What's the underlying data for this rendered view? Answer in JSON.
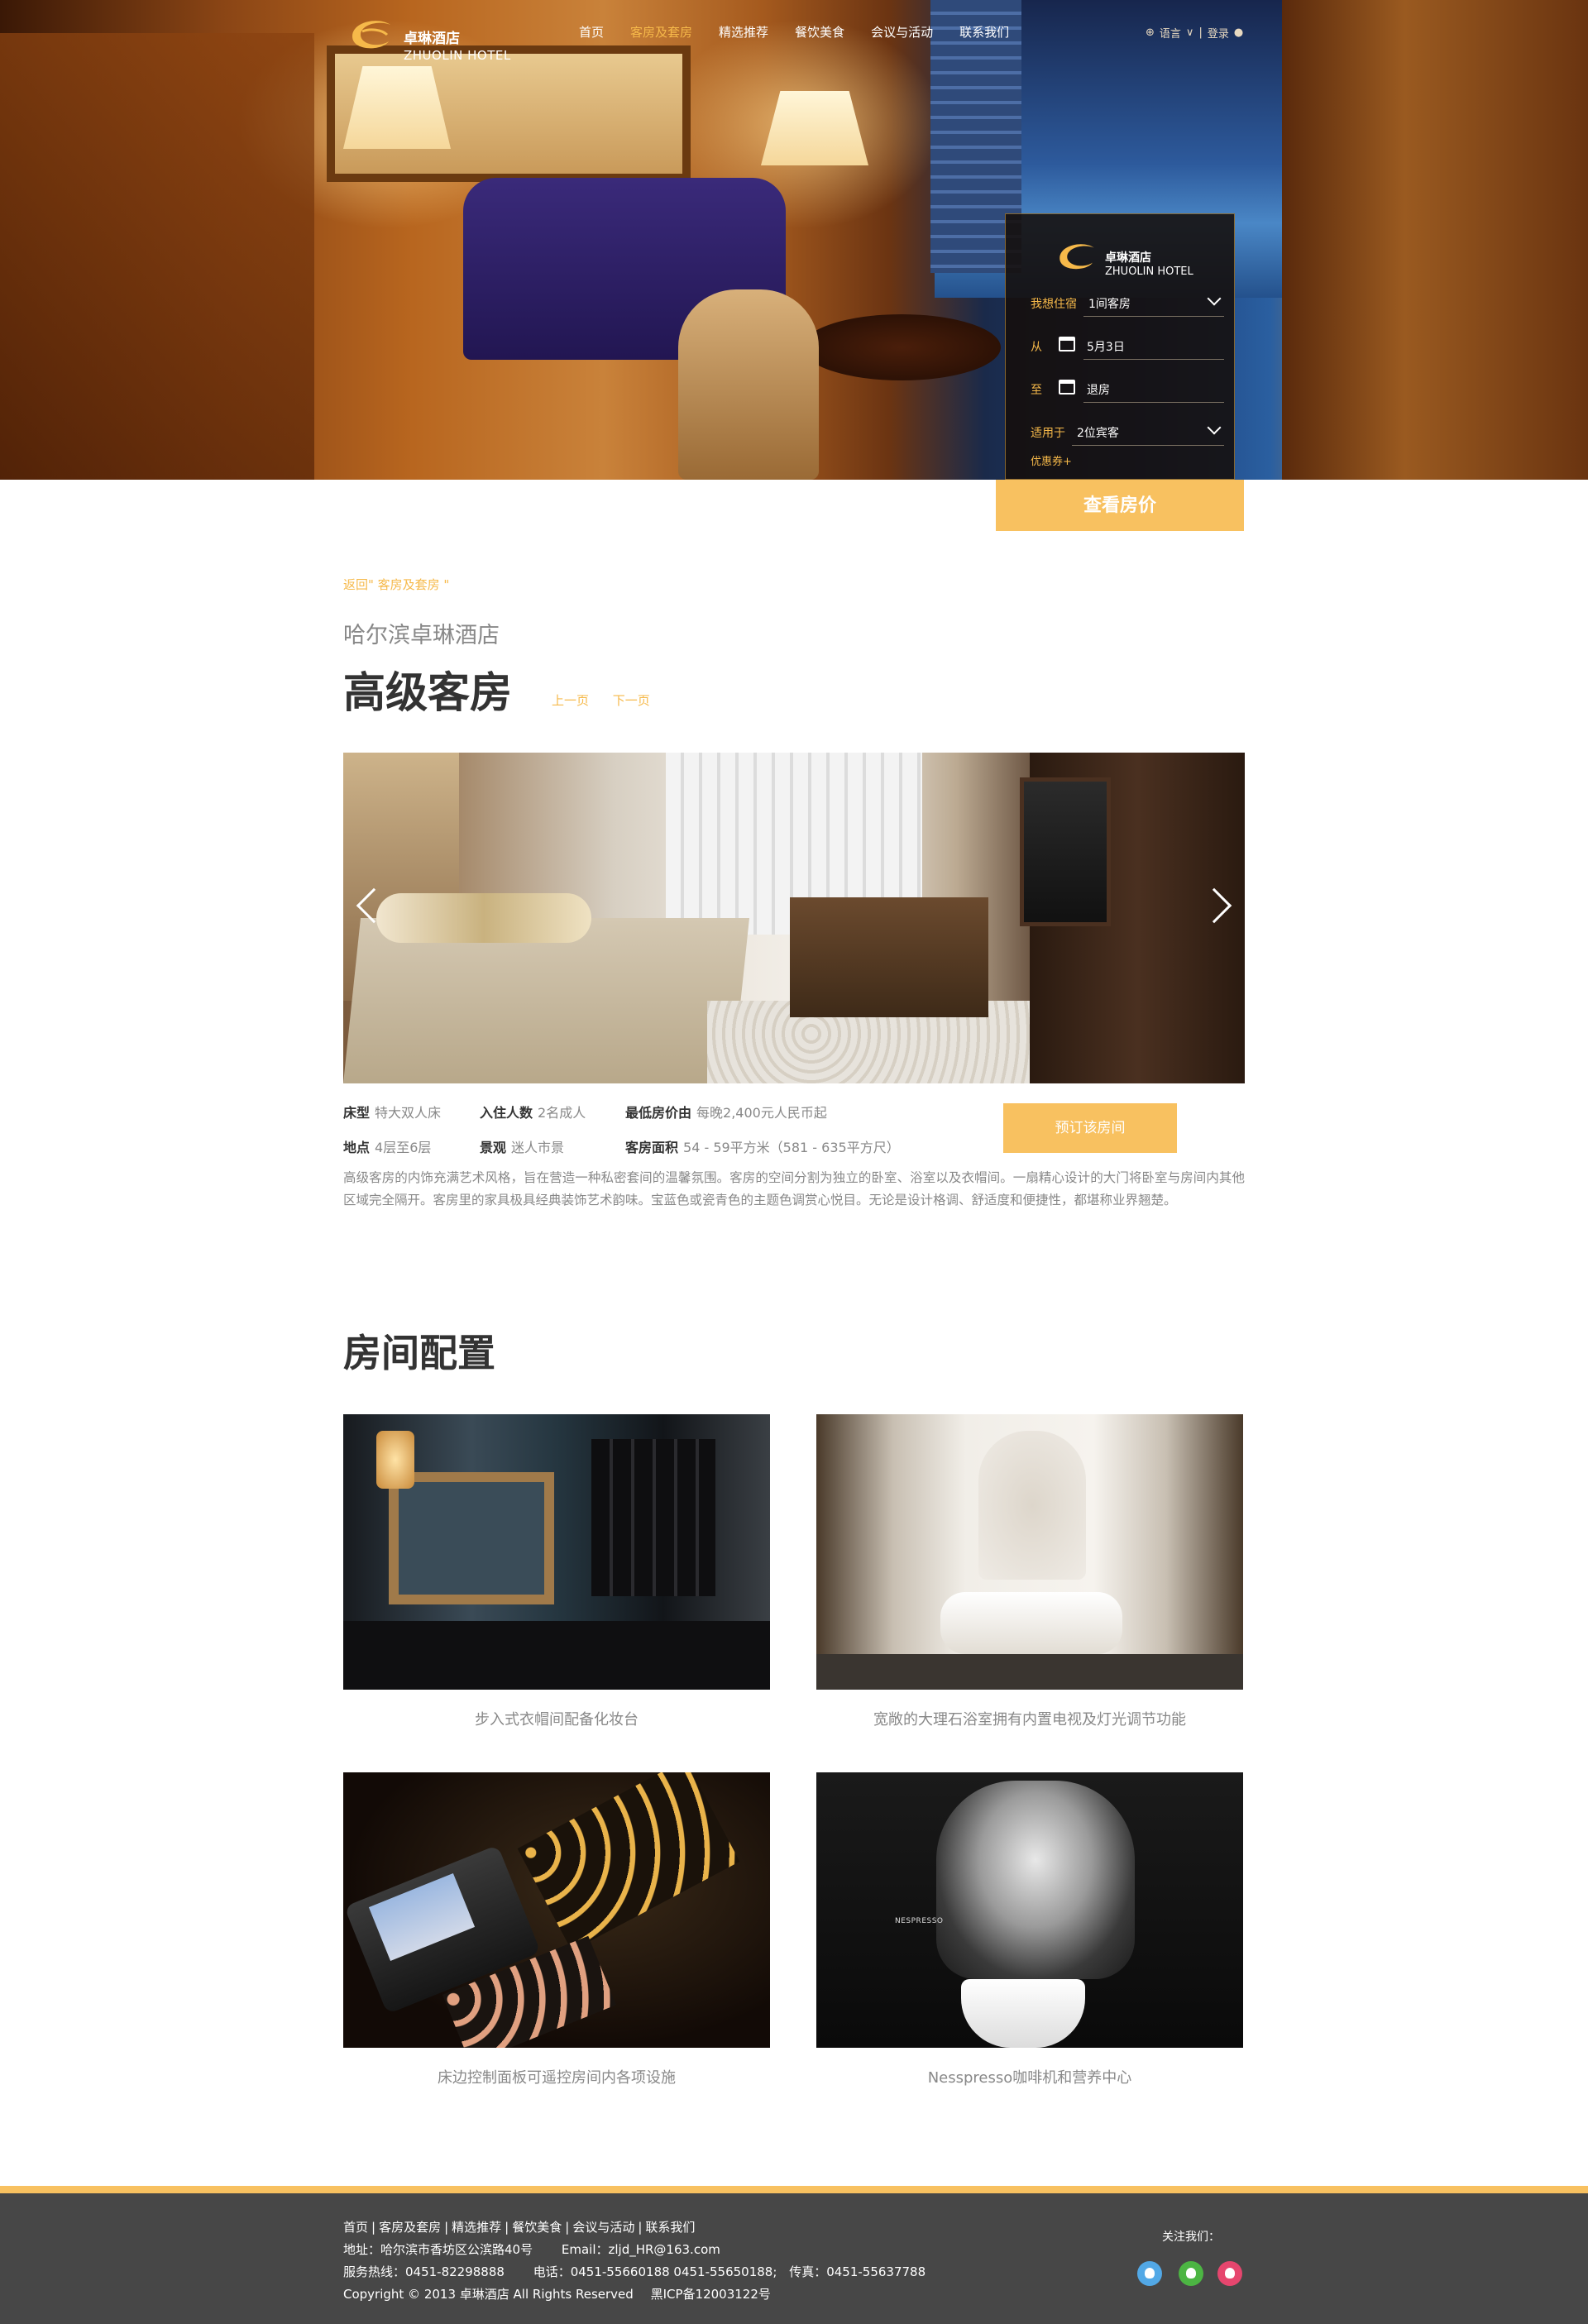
{
  "brand": {
    "name_cn": "卓琳酒店",
    "name_en": "ZHUOLIN HOTEL",
    "accent_color": "#f8c160",
    "footer_bg": "#474747"
  },
  "nav": {
    "items": [
      "首页",
      "客房及套房",
      "精选推荐",
      "餐饮美食",
      "会议与活动",
      "联系我们"
    ],
    "active_index": 1,
    "language_label": "语言",
    "login_label": "登录"
  },
  "booking": {
    "stay_label": "我想住宿",
    "rooms_value": "1间客房",
    "from_label": "从",
    "checkin_value": "5月3日",
    "to_label": "至",
    "checkout_value": "退房",
    "applies_label": "适用于",
    "guests_value": "2位宾客",
    "coupon_label": "优惠券+",
    "submit_label": "查看房价"
  },
  "content": {
    "back_link": "返回\" 客房及套房 \"",
    "hotel_name": "哈尔滨卓琳酒店",
    "room_title": "高级客房",
    "prev_label": "上一页",
    "next_label": "下一页",
    "details": {
      "bed_label": "床型",
      "bed_value": "特大双人床",
      "occupancy_label": "入住人数",
      "occupancy_value": "2名成人",
      "price_label": "最低房价由",
      "price_value": "每晚2,400元人民币起",
      "location_label": "地点",
      "location_value": "4层至6层",
      "view_label": "景观",
      "view_value": "迷人市景",
      "area_label": "客房面积",
      "area_value": "54 - 59平方米（581 - 635平方尺）"
    },
    "book_label": "预订该房间",
    "description": "高级客房的内饰充满艺术风格，旨在营造一种私密套间的温馨氛围。客房的空间分割为独立的卧室、浴室以及衣帽间。一扇精心设计的大门将卧室与房间内其他区域完全隔开。客房里的家具极具经典装饰艺术韵味。宝蓝色或瓷青色的主题色调赏心悦目。无论是设计格调、舒适度和便捷性，都堪称业界翘楚。"
  },
  "amenities": {
    "title": "房间配置",
    "items": [
      {
        "caption": "步入式衣帽间配备化妆台"
      },
      {
        "caption": "宽敞的大理石浴室拥有内置电视及灯光调节功能"
      },
      {
        "caption": "床边控制面板可遥控房间内各项设施"
      },
      {
        "caption": "Nesspresso咖啡机和营养中心",
        "brand_mark": "NESPRESSO"
      }
    ]
  },
  "footer": {
    "links": [
      "首页",
      "客房及套房",
      "精选推荐",
      "餐饮美食",
      "会议与活动",
      "联系我们"
    ],
    "address": "地址：哈尔滨市香坊区公滨路40号",
    "email": "Email：zljd_HR@163.com",
    "hotline": "服务热线：0451-82298888",
    "phone": "电话：0451-55660188  0451-55650188;",
    "fax": "传真：0451-55637788",
    "copyright": "Copyright © 2013 卓琳酒店 All Rights Reserved",
    "icp": "黑ICP备12003122号",
    "follow_label": "关注我们：",
    "social_icons": [
      "qq-icon",
      "wechat-icon",
      "weibo-icon"
    ]
  }
}
